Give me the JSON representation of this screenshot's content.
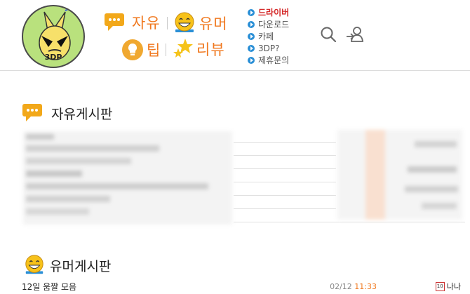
{
  "logo": {
    "text": "3DP"
  },
  "nav": [
    {
      "label": "자유",
      "icon": "chat-bubble-icon"
    },
    {
      "label": "유머",
      "icon": "laughing-face-icon"
    },
    {
      "label": "팁",
      "icon": "lightbulb-icon"
    },
    {
      "label": "리뷰",
      "icon": "stars-icon"
    }
  ],
  "links": [
    {
      "label": "드라이버",
      "active": true
    },
    {
      "label": "다운로드"
    },
    {
      "label": "카페"
    },
    {
      "label": "3DP?"
    },
    {
      "label": "제휴문의"
    }
  ],
  "sections": {
    "free": {
      "title": "자유게시판"
    },
    "humor": {
      "title": "유머게시판"
    }
  },
  "humor_post": {
    "title": "12일 움짤 모음",
    "date": "02/12",
    "time": "11:33",
    "level": "10",
    "author": "나나"
  },
  "colors": {
    "accent": "#f0781e",
    "active_link": "#d52a2a",
    "link_bullet": "#2a8fd6"
  }
}
